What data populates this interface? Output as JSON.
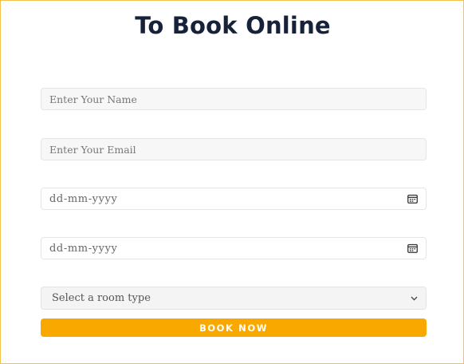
{
  "form": {
    "title": "To Book Online",
    "name_placeholder": "Enter Your Name",
    "email_placeholder": "Enter Your Email",
    "checkin_placeholder": "dd-mm-yyyy",
    "checkout_placeholder": "dd-mm-yyyy",
    "room_select_value": "Select a room type",
    "submit_label": "BOOK NOW"
  },
  "colors": {
    "accent": "#f9a800",
    "title": "#16213a",
    "border": "#f3c24a"
  },
  "icons": {
    "date": "calendar-icon",
    "select": "chevron-down-icon"
  }
}
